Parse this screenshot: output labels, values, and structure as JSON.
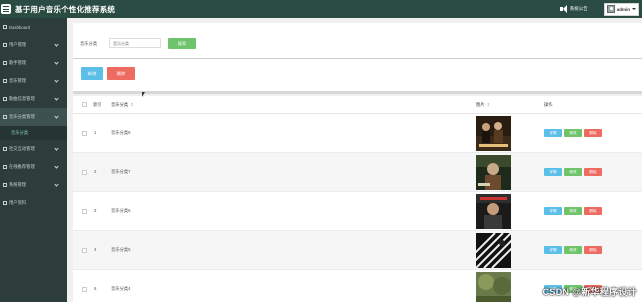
{
  "header": {
    "app_title": "基于用户音乐个性化推荐系统",
    "site_link": "系统公告",
    "user_name": "admin"
  },
  "sidebar": {
    "items": [
      {
        "label": "Dashboard",
        "icon": "home-icon"
      },
      {
        "label": "用户管理",
        "icon": "users-icon"
      },
      {
        "label": "歌手管理",
        "icon": "grid-icon"
      },
      {
        "label": "音乐管理",
        "icon": "music-icon"
      },
      {
        "label": "歌曲信息管理",
        "icon": "grid-icon"
      },
      {
        "label": "音乐分类管理",
        "icon": "grid-icon"
      },
      {
        "label": "社交互动管理",
        "icon": "flag-icon"
      },
      {
        "label": "在线推荐管理",
        "icon": "grid-icon"
      },
      {
        "label": "系统管理",
        "icon": "gear-icon"
      },
      {
        "label": "用户资料",
        "icon": "profile-icon"
      }
    ],
    "sub_item": "音乐分类"
  },
  "search": {
    "label": "音乐分类",
    "placeholder": "音乐分类",
    "button": "搜索"
  },
  "actions": {
    "add": "新增",
    "delete": "删除"
  },
  "table": {
    "columns": [
      "索引",
      "音乐分类",
      "图片",
      "操作"
    ],
    "rows": [
      {
        "index": "1",
        "category": "音乐分类8"
      },
      {
        "index": "2",
        "category": "音乐分类7"
      },
      {
        "index": "3",
        "category": "音乐分类6"
      },
      {
        "index": "4",
        "category": "音乐分类5"
      },
      {
        "index": "5",
        "category": "音乐分类4"
      }
    ],
    "op_detail": "详情",
    "op_edit": "修改",
    "op_delete": "删除"
  },
  "watermark": "CSDN @新华程序设计",
  "colors": {
    "topbar": "#2b4c42",
    "sidebar": "#2d3d3b",
    "primary_blue": "#5bbfe7",
    "success_green": "#6fc46b",
    "danger_red": "#ee6b62"
  }
}
